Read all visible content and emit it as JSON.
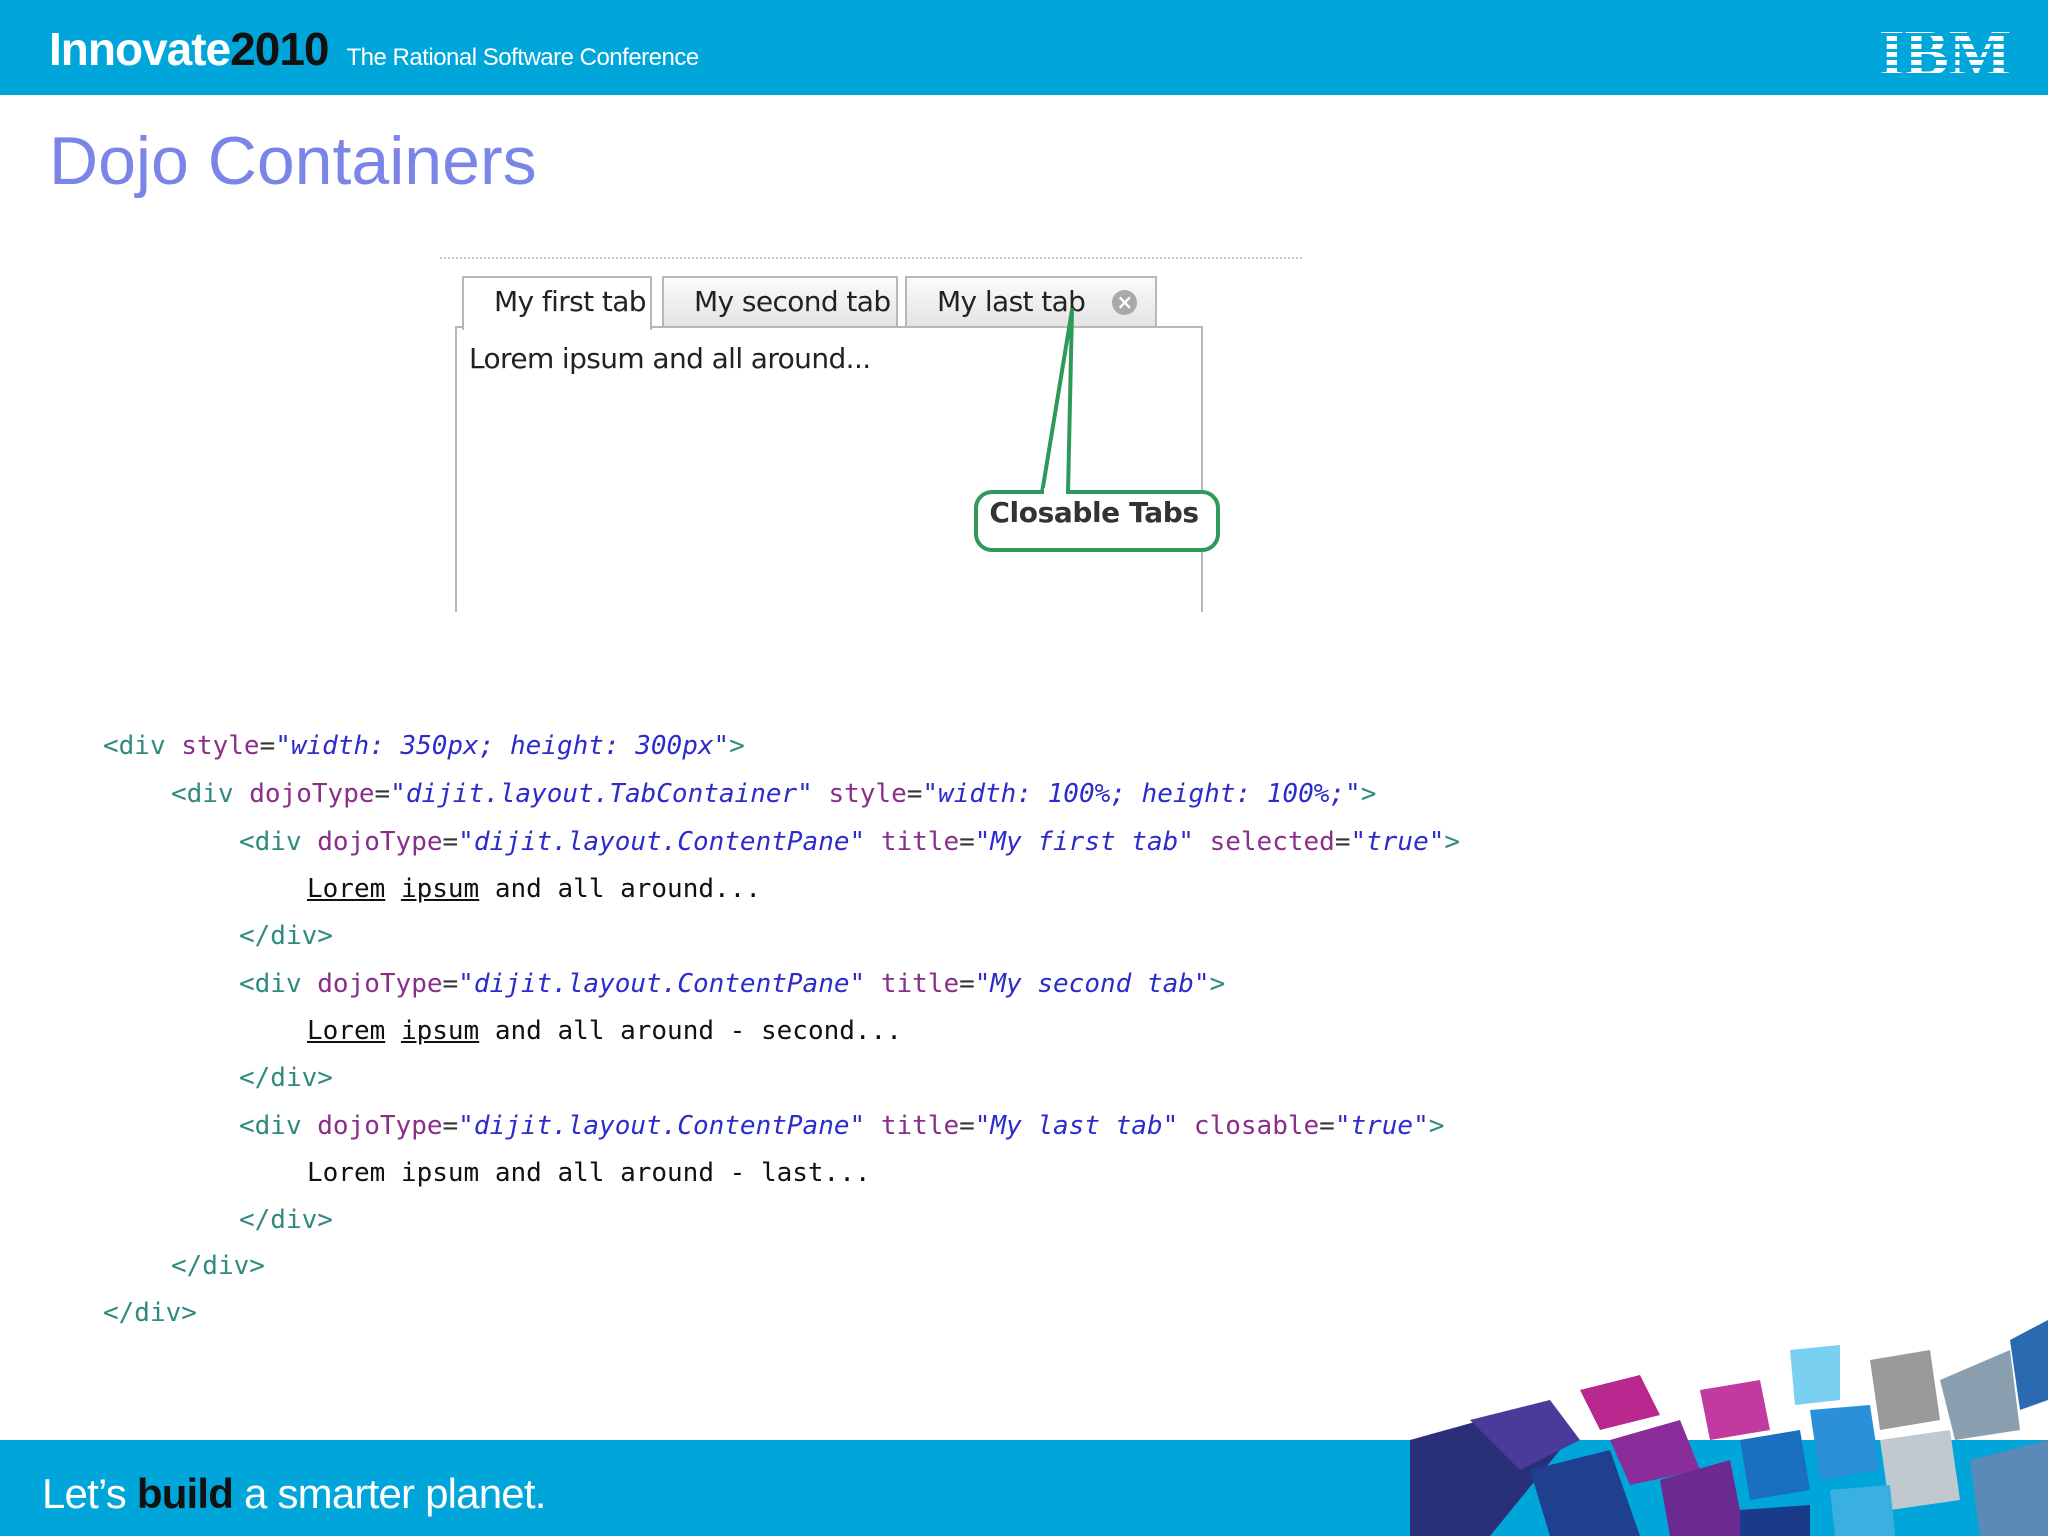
{
  "header": {
    "brand_word": "Innovate",
    "brand_year": "2010",
    "conference": "The Rational Software Conference",
    "logo": "IBM"
  },
  "slide": {
    "title": "Dojo Containers"
  },
  "demo": {
    "tabs": [
      {
        "label": "My first tab",
        "active": true
      },
      {
        "label": "My second tab",
        "active": false
      },
      {
        "label": "My last tab",
        "active": false,
        "closable": true
      }
    ],
    "pane_text": "Lorem ipsum and all around...",
    "callout": "Closable Tabs",
    "close_icon": "close-icon",
    "colors": {
      "callout_border": "#2e9a5a",
      "tab_border": "#b8b8b8"
    }
  },
  "code": {
    "l1": {
      "open": "<div",
      "a1": "style",
      "v1": "\"width: 350px; height: 300px\"",
      "close": ">"
    },
    "l2": {
      "open": "<div",
      "a1": "dojoType",
      "v1": "\"dijit.layout.TabContainer\"",
      "a2": "style",
      "v2": "\"width: 100%; height: 100%;\"",
      "close": ">"
    },
    "l3": {
      "open": "<div",
      "a1": "dojoType",
      "v1": "\"dijit.layout.ContentPane\"",
      "a2": "title",
      "v2": "\"My first tab\"",
      "a3": "selected",
      "v3": "\"true\"",
      "close": ">"
    },
    "l4": {
      "w1": "Lorem",
      "w2": "ipsum",
      "rest": "and all around..."
    },
    "l5": "</div>",
    "l6": {
      "open": "<div",
      "a1": "dojoType",
      "v1": "\"dijit.layout.ContentPane\"",
      "a2": "title",
      "v2": "\"My second tab\"",
      "close": ">"
    },
    "l7": {
      "w1": "Lorem",
      "w2": "ipsum",
      "rest": "and all around - second..."
    },
    "l8": "</div>",
    "l9": {
      "open": "<div",
      "a1": "dojoType",
      "v1": "\"dijit.layout.ContentPane\"",
      "a2": "title",
      "v2": "\"My last tab\"",
      "a3": "closable",
      "v3": "\"true\"",
      "close": ">"
    },
    "l10": "Lorem ipsum and all around - last...",
    "l11": "</div>",
    "l12": "</div>",
    "l13": "</div>"
  },
  "footer": {
    "tagline_1": "Let’s",
    "tagline_bold": "build",
    "tagline_2": "a smarter planet."
  }
}
